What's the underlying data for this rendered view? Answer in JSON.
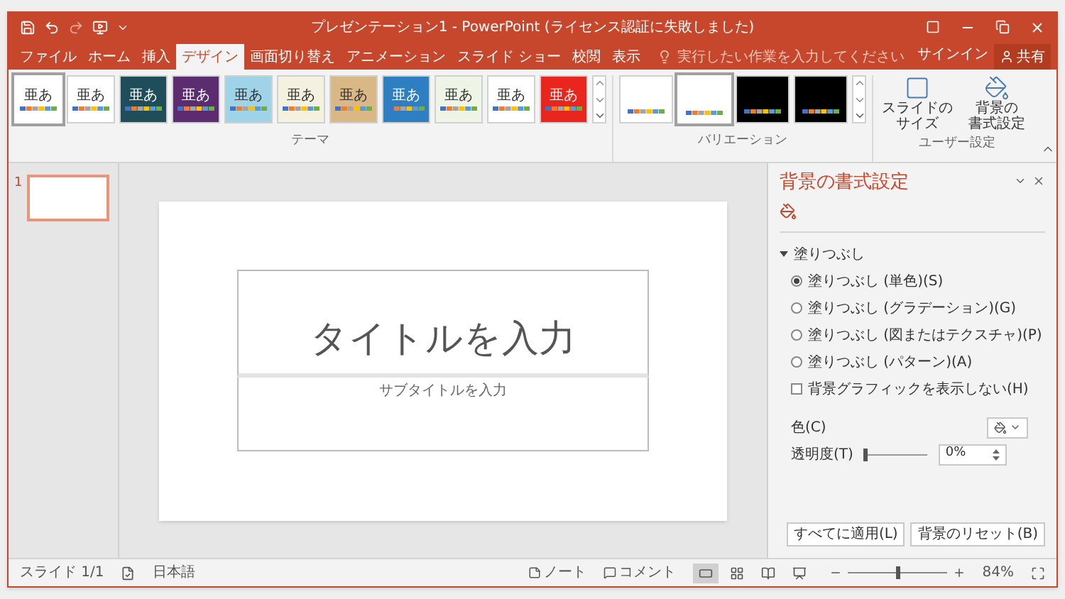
{
  "window": {
    "title": "プレゼンテーション1 - PowerPoint (ライセンス認証に失敗しました)"
  },
  "tabs": [
    {
      "label": "ファイル",
      "selected": false
    },
    {
      "label": "ホーム",
      "selected": false
    },
    {
      "label": "挿入",
      "selected": false
    },
    {
      "label": "デザイン",
      "selected": true
    },
    {
      "label": "画面切り替え",
      "selected": false
    },
    {
      "label": "アニメーション",
      "selected": false
    },
    {
      "label": "スライド ショー",
      "selected": false
    },
    {
      "label": "校閲",
      "selected": false
    },
    {
      "label": "表示",
      "selected": false
    }
  ],
  "tell_me": {
    "placeholder": "実行したい作業を入力してください"
  },
  "account": {
    "sign_in": "サインイン",
    "share": "共有"
  },
  "themes": {
    "label": "テーマ",
    "items": [
      {
        "sample": "亜あ",
        "color": "#ffffff",
        "selected": true
      },
      {
        "sample": "亜あ",
        "color": "#ffffff",
        "selected": false
      },
      {
        "sample": "亜あ",
        "color": "#1f4e5a",
        "selected": false
      },
      {
        "sample": "亜あ",
        "color": "#5b2c6f",
        "selected": false
      },
      {
        "sample": "亜あ",
        "color": "#9fd3e8",
        "selected": false
      },
      {
        "sample": "亜あ",
        "color": "#f4f1e1",
        "selected": false
      },
      {
        "sample": "亜あ",
        "color": "#d9b886",
        "selected": false
      },
      {
        "sample": "亜あ",
        "color": "#2d7fc1",
        "selected": false
      },
      {
        "sample": "亜あ",
        "color": "#eef5e6",
        "selected": false
      },
      {
        "sample": "亜あ",
        "color": "#ffffff",
        "selected": false
      },
      {
        "sample": "亜あ",
        "color": "#e8261d",
        "selected": false
      }
    ]
  },
  "variants": {
    "label": "バリエーション",
    "items": [
      {
        "color": "#ffffff",
        "selected": false
      },
      {
        "color": "#ffffff",
        "selected": true
      },
      {
        "color": "#000000",
        "selected": false
      },
      {
        "color": "#000000",
        "selected": false
      }
    ]
  },
  "customize": {
    "label": "ユーザー設定",
    "buttons": [
      {
        "kind": "slide-size",
        "lines": [
          "スライドの",
          "サイズ"
        ]
      },
      {
        "kind": "background",
        "lines": [
          "背景の",
          "書式設定"
        ]
      }
    ]
  },
  "slides": [
    {
      "number": "1",
      "selected": true
    }
  ],
  "slide": {
    "title": "タイトルを入力",
    "subtitle": "サブタイトルを入力"
  },
  "format_pane": {
    "title": "背景の書式設定",
    "section": {
      "label": "塗りつぶし",
      "expanded": true
    },
    "fill_options": [
      {
        "label": "塗りつぶし (単色)(S)",
        "selected": true
      },
      {
        "label": "塗りつぶし (グラデーション)(G)",
        "selected": false
      },
      {
        "label": "塗りつぶし (図またはテクスチャ)(P)",
        "selected": false
      },
      {
        "label": "塗りつぶし (パターン)(A)",
        "selected": false
      }
    ],
    "hide_graphics": {
      "label": "背景グラフィックを表示しない(H)",
      "checked": false
    },
    "color_label": "色(C)",
    "transparency": {
      "label": "透明度(T)",
      "level": 0,
      "value": "0%"
    },
    "buttons": [
      "すべてに適用(L)",
      "背景のリセット(B)"
    ]
  },
  "status_bar": {
    "slide": "スライド 1/1",
    "language": "日本語",
    "notes": "ノート",
    "comments": "コメント",
    "views": [
      {
        "kind": "normal",
        "selected": true
      },
      {
        "kind": "sorter",
        "selected": false
      },
      {
        "kind": "reading",
        "selected": false
      },
      {
        "kind": "show",
        "selected": false
      }
    ],
    "zoom": {
      "level": 0.5,
      "reading": "84%"
    }
  }
}
